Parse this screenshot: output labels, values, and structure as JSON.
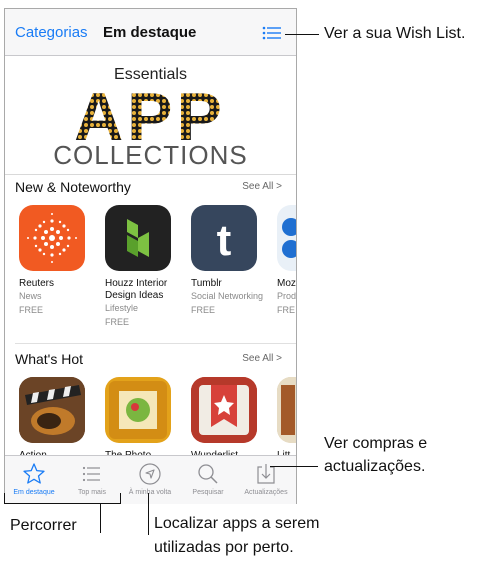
{
  "navbar": {
    "categories_label": "Categorias",
    "title": "Em destaque",
    "wishlist_icon": "list-icon",
    "accent": "#1a7cf5"
  },
  "banner": {
    "top": "Essentials",
    "big": "APP",
    "bottom": "COLLECTIONS"
  },
  "new_noteworthy": {
    "title": "New & Noteworthy",
    "see_all": "See All >",
    "apps": [
      {
        "name": "Reuters",
        "category": "News",
        "price": "FREE",
        "icon": "reuters-icon"
      },
      {
        "name": "Houzz Interior Design Ideas",
        "category": "Lifestyle",
        "price": "FREE",
        "icon": "houzz-icon"
      },
      {
        "name": "Tumblr",
        "category": "Social Networking",
        "price": "FREE",
        "icon": "tumblr-icon"
      },
      {
        "name": "Moz Bin",
        "category": "Prod",
        "price": "FRE",
        "icon": "partial-app-icon"
      }
    ]
  },
  "whats_hot": {
    "title": "What's Hot",
    "see_all": "See All >",
    "apps": [
      {
        "name": "Action",
        "icon": "movie-clapper-icon"
      },
      {
        "name": "The Photo",
        "icon": "photo-frame-icon"
      },
      {
        "name": "Wunderlist",
        "icon": "wunderlist-icon"
      },
      {
        "name": "Litt",
        "icon": "partial-app-icon"
      }
    ]
  },
  "tabs": [
    {
      "label": "Em destaque",
      "icon": "star-icon",
      "active": true
    },
    {
      "label": "Top mais",
      "icon": "list-icon",
      "active": false
    },
    {
      "label": "À minha volta",
      "icon": "location-arrow-icon",
      "active": false
    },
    {
      "label": "Pesquisar",
      "icon": "search-icon",
      "active": false
    },
    {
      "label": "Actualizações",
      "icon": "download-icon",
      "active": false
    }
  ],
  "callouts": {
    "wishlist": "Ver a sua Wish List.",
    "purchases_line1": "Ver compras e",
    "purchases_line2": "actualizações.",
    "browse": "Percorrer",
    "nearby_line1": "Localizar apps a serem",
    "nearby_line2": "utilizadas por perto."
  }
}
